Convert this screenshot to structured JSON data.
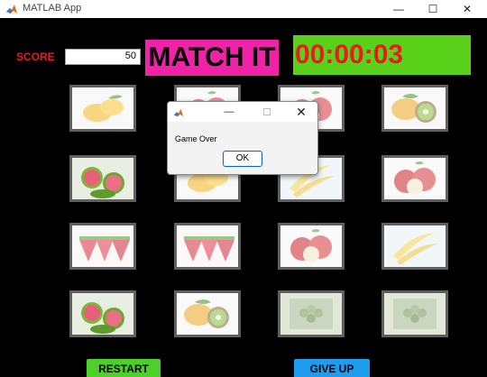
{
  "window": {
    "title": "MATLAB App",
    "minimize_glyph": "—",
    "maximize_glyph": "☐",
    "close_glyph": "✕"
  },
  "header": {
    "score_label": "SCORE",
    "score_value": "50",
    "game_title": "MATCH IT",
    "timer": "00:00:03"
  },
  "colors": {
    "title_bg": "#ef22a8",
    "timer_bg": "#59d11a",
    "timer_text": "#e81c1c",
    "restart_bg": "#4cd12a",
    "giveup_bg": "#1e9cf0"
  },
  "cards": [
    {
      "fruit": "mango",
      "dimmed": true
    },
    {
      "fruit": "apple",
      "dimmed": true
    },
    {
      "fruit": "apple",
      "dimmed": true
    },
    {
      "fruit": "mango-kiwi",
      "dimmed": true
    },
    {
      "fruit": "guava",
      "dimmed": false
    },
    {
      "fruit": "mango",
      "dimmed": true
    },
    {
      "fruit": "banana",
      "dimmed": true
    },
    {
      "fruit": "apple",
      "dimmed": true
    },
    {
      "fruit": "strawberry",
      "dimmed": true
    },
    {
      "fruit": "strawberry",
      "dimmed": true
    },
    {
      "fruit": "apple",
      "dimmed": true
    },
    {
      "fruit": "banana",
      "dimmed": true
    },
    {
      "fruit": "guava",
      "dimmed": false
    },
    {
      "fruit": "mango-kiwi",
      "dimmed": true
    },
    {
      "fruit": "grapes",
      "dimmed": true
    },
    {
      "fruit": "grapes",
      "dimmed": true
    }
  ],
  "buttons": {
    "restart": "RESTART",
    "give_up": "GIVE UP"
  },
  "dialog": {
    "message": "Game Over",
    "ok_label": "OK",
    "minimize_glyph": "—",
    "maximize_glyph": "☐",
    "close_glyph": "✕"
  }
}
